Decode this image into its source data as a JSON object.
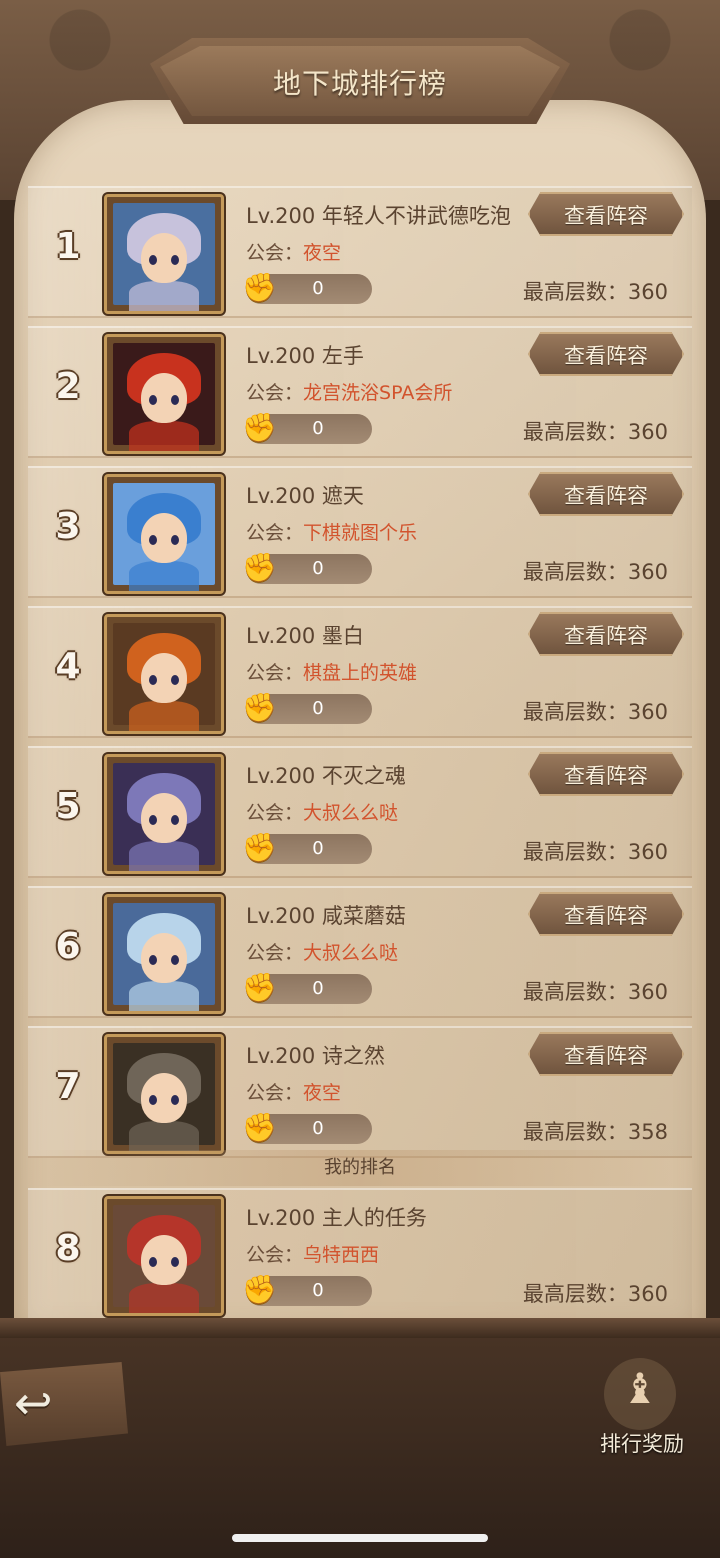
{
  "title": "地下城排行榜",
  "guild_prefix": "公会：",
  "floor_prefix": "最高层数：",
  "view_label": "查看阵容",
  "my_rank_label": "我的排名",
  "reward_label": "排行奖励",
  "colors": {
    "guild": "#d2532d",
    "text": "#5a4330",
    "button": "#8a6a4e"
  },
  "icons": {
    "like": "thumbs-up-icon",
    "back": "back-arrow-icon",
    "reward": "chess-trophy-icon"
  },
  "rankings": [
    {
      "rank": "1",
      "level_name": "Lv.200 年轻人不讲武德吃泡",
      "guild": "夜空",
      "likes": "0",
      "max_floor": "360",
      "hair": "#c7c2dc",
      "bg": "#4a6fa0"
    },
    {
      "rank": "2",
      "level_name": "Lv.200 左手",
      "guild": "龙宫洗浴SPA会所",
      "likes": "0",
      "max_floor": "360",
      "hair": "#c8321e",
      "bg": "#3a1a1a"
    },
    {
      "rank": "3",
      "level_name": "Lv.200 遮天",
      "guild": "下棋就图个乐",
      "likes": "0",
      "max_floor": "360",
      "hair": "#3a7fcf",
      "bg": "#6a9fdc"
    },
    {
      "rank": "4",
      "level_name": "Lv.200 墨白",
      "guild": "棋盘上的英雄",
      "likes": "0",
      "max_floor": "360",
      "hair": "#d0621e",
      "bg": "#5a3a22"
    },
    {
      "rank": "5",
      "level_name": "Lv.200 不灭之魂",
      "guild": "大叔么么哒",
      "likes": "0",
      "max_floor": "360",
      "hair": "#7d78b8",
      "bg": "#3a2f55"
    },
    {
      "rank": "6",
      "level_name": "Lv.200 咸菜蘑菇",
      "guild": "大叔么么哒",
      "likes": "0",
      "max_floor": "360",
      "hair": "#b8d4ea",
      "bg": "#4a6a9a"
    },
    {
      "rank": "7",
      "level_name": "Lv.200 诗之然",
      "guild": "夜空",
      "likes": "0",
      "max_floor": "358",
      "hair": "#6f6558",
      "bg": "#3a3024"
    }
  ],
  "my_rank": {
    "rank": "8",
    "level_name": "Lv.200 主人的任务",
    "guild": "乌特西西",
    "likes": "0",
    "max_floor": "360",
    "hair": "#b5352a",
    "bg": "#6a4a38"
  }
}
